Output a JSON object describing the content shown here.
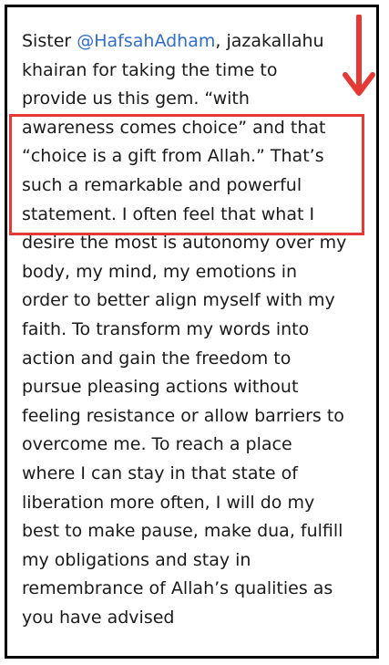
{
  "comment": {
    "lines": [
      {
        "before": "Sister ",
        "mention": "@HafsahAdham",
        "after": ", jazakallahu"
      },
      "khairan  for taking the time to",
      "provide us this gem. “with",
      "awareness comes choice” and that",
      "“choice is a gift from Allah.” That’s",
      "such a remarkable and powerful",
      "statement. I often feel that what I",
      "desire the most is autonomy over my",
      "body, my mind, my emotions in",
      "order to better align myself with my",
      "faith. To transform my words into",
      "action and gain the freedom to",
      "pursue pleasing actions without",
      "feeling resistance or allow barriers to",
      "overcome me. To reach a place",
      "where I can stay in that state of",
      "liberation more often, I will do my",
      "best to make pause, make dua, fulfill",
      "my obligations and stay in",
      "remembrance of Allah’s qualities as",
      "you have advised"
    ]
  },
  "annotation": {
    "highlight_color": "#e53935",
    "arrow_color": "#e53935",
    "arrow_icon": "down-arrow-icon"
  },
  "colors": {
    "text": "#1a1a1a",
    "mention": "#2f6ecf",
    "frame": "#000000"
  }
}
